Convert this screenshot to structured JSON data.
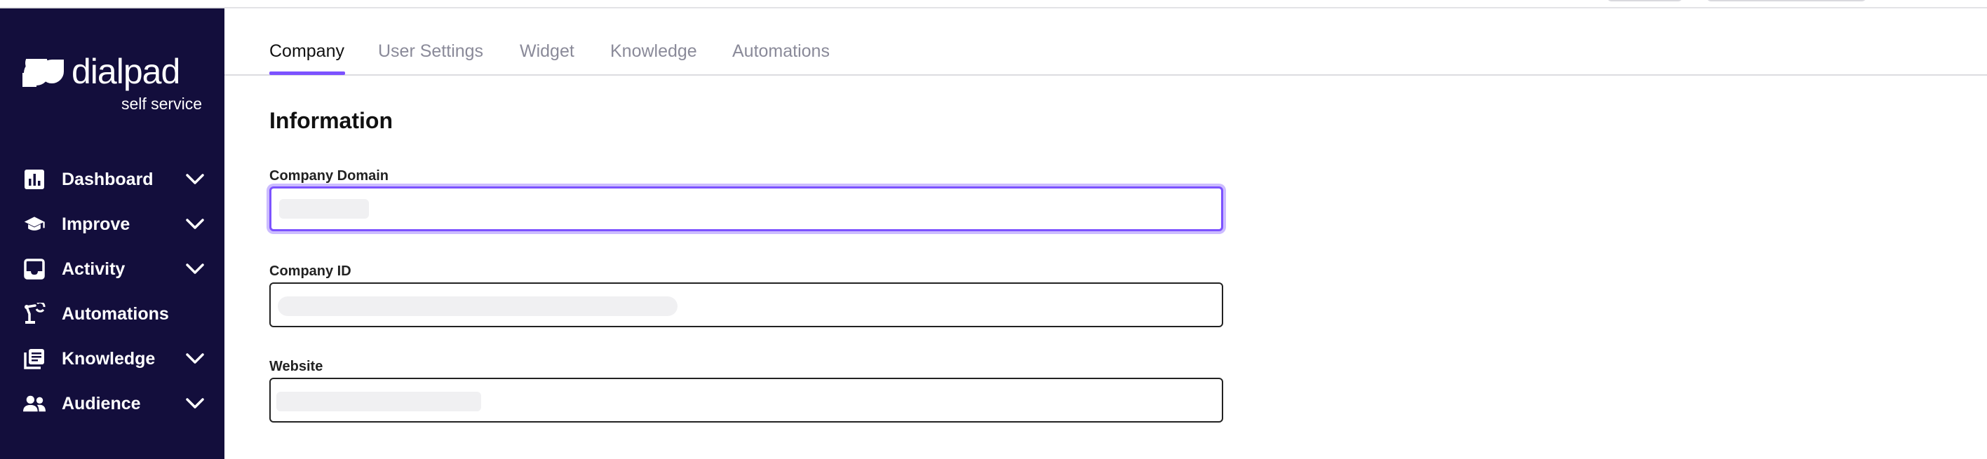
{
  "app": {
    "brand_name": "dialpad",
    "brand_subtitle": "self service"
  },
  "colors": {
    "sidebar_bg": "#130e3c",
    "accent": "#7c52ff",
    "focus_ring": "#ccbcff",
    "tab_inactive": "#8a8a99",
    "redaction": "#f0f0f2"
  },
  "sidebar": {
    "items": [
      {
        "label": "Dashboard",
        "icon": "bar-chart-icon",
        "has_chevron": true
      },
      {
        "label": "Improve",
        "icon": "graduation-cap-icon",
        "has_chevron": true
      },
      {
        "label": "Activity",
        "icon": "inbox-icon",
        "has_chevron": true
      },
      {
        "label": "Automations",
        "icon": "robot-arm-icon",
        "has_chevron": false
      },
      {
        "label": "Knowledge",
        "icon": "library-icon",
        "has_chevron": true
      },
      {
        "label": "Audience",
        "icon": "people-icon",
        "has_chevron": true
      }
    ]
  },
  "tabs": [
    {
      "label": "Company",
      "active": true
    },
    {
      "label": "User Settings",
      "active": false
    },
    {
      "label": "Widget",
      "active": false
    },
    {
      "label": "Knowledge",
      "active": false
    },
    {
      "label": "Automations",
      "active": false
    }
  ],
  "form": {
    "title": "Information",
    "fields": [
      {
        "label": "Company Domain",
        "value": "",
        "focused": true
      },
      {
        "label": "Company ID",
        "value": "",
        "focused": false
      },
      {
        "label": "Website",
        "value": "",
        "focused": false
      }
    ]
  }
}
